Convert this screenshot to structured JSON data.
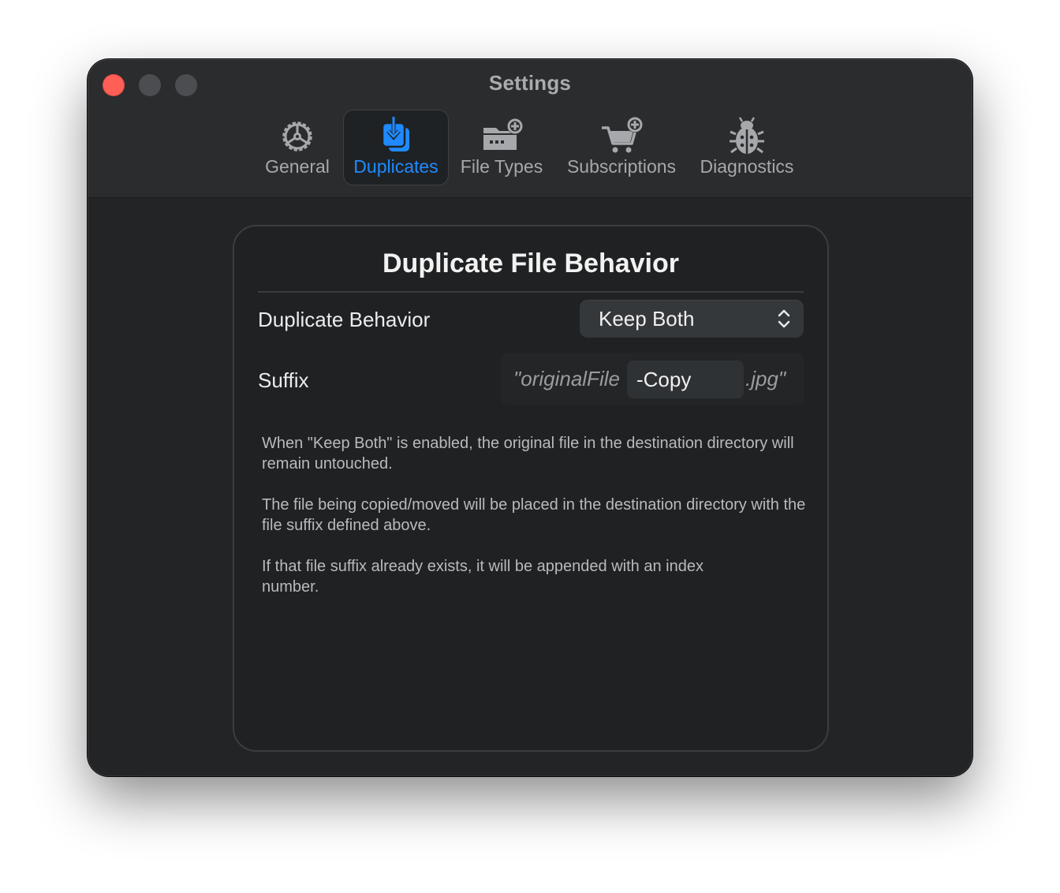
{
  "window": {
    "title": "Settings"
  },
  "tabs": [
    {
      "label": "General",
      "icon": "gear-icon",
      "active": false
    },
    {
      "label": "Duplicates",
      "icon": "duplicate-download-icon",
      "active": true
    },
    {
      "label": "File Types",
      "icon": "folder-add-icon",
      "active": false
    },
    {
      "label": "Subscriptions",
      "icon": "cart-add-icon",
      "active": false
    },
    {
      "label": "Diagnostics",
      "icon": "bug-icon",
      "active": false
    }
  ],
  "panel": {
    "title": "Duplicate File Behavior",
    "duplicate_behavior": {
      "label": "Duplicate Behavior",
      "value": "Keep Both"
    },
    "suffix": {
      "label": "Suffix",
      "prefix_example": "\"originalFile",
      "value": "-Copy",
      "extension_example": ".jpg\""
    },
    "descriptions": [
      "When \"Keep Both\" is enabled, the original file in the destination directory will remain untouched.",
      "The file being copied/moved will be placed in the destination directory with the file suffix defined above.",
      "If that file suffix already exists, it will be appended with an index number."
    ]
  },
  "colors": {
    "accent": "#1f8aff",
    "close": "#ff5f57",
    "window_bg": "#222426"
  }
}
